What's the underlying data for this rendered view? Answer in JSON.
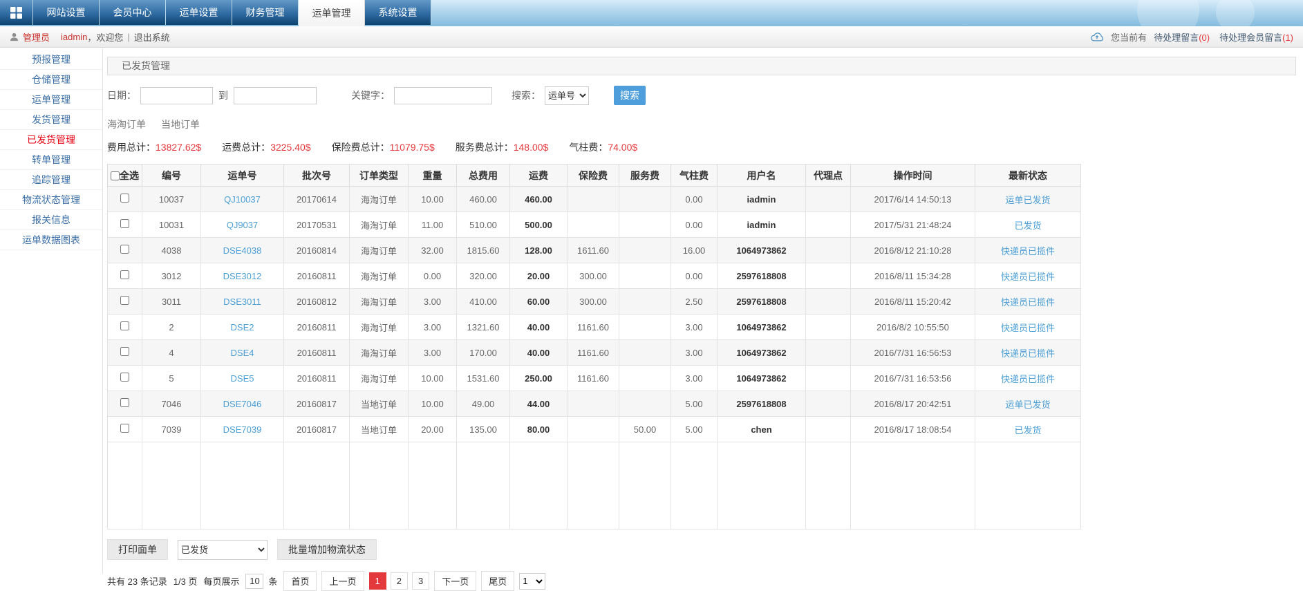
{
  "nav": {
    "tabs": [
      {
        "label": "网站设置",
        "active": false
      },
      {
        "label": "会员中心",
        "active": false
      },
      {
        "label": "运单设置",
        "active": false
      },
      {
        "label": "财务管理",
        "active": false
      },
      {
        "label": "运单管理",
        "active": true
      },
      {
        "label": "系统设置",
        "active": false
      }
    ]
  },
  "user_bar": {
    "role": "管理员",
    "username": "iadmin",
    "welcome_suffix": "，欢迎您",
    "divider": "|",
    "logout": "退出系统",
    "notice_prefix": "您当前有",
    "notices": [
      {
        "label": "待处理留言",
        "count": "(0)"
      },
      {
        "label": "待处理会员留言",
        "count": "(1)"
      }
    ]
  },
  "sidebar": {
    "items": [
      {
        "label": "预报管理",
        "active": false
      },
      {
        "label": "仓储管理",
        "active": false
      },
      {
        "label": "运单管理",
        "active": false
      },
      {
        "label": "发货管理",
        "active": false
      },
      {
        "label": "已发货管理",
        "active": true
      },
      {
        "label": "转单管理",
        "active": false
      },
      {
        "label": "追踪管理",
        "active": false
      },
      {
        "label": "物流状态管理",
        "active": false
      },
      {
        "label": "报关信息",
        "active": false
      },
      {
        "label": "运单数据图表",
        "active": false
      }
    ]
  },
  "panel_title": "已发货管理",
  "filters": {
    "date_label": "日期：",
    "to_label": "到",
    "keyword_label": "关键字：",
    "search_label": "搜索：",
    "date_from_value": "",
    "date_to_value": "",
    "keyword_value": "",
    "search_type_selected": "运单号",
    "search_button": "搜索"
  },
  "order_tabs": [
    {
      "label": "海淘订单"
    },
    {
      "label": "当地订单"
    }
  ],
  "totals": [
    {
      "label": "费用总计：",
      "value": "13827.62$"
    },
    {
      "label": "运费总计：",
      "value": "3225.40$"
    },
    {
      "label": "保险费总计：",
      "value": "11079.75$"
    },
    {
      "label": "服务费总计：",
      "value": "148.00$"
    },
    {
      "label": "气柱费：",
      "value": "74.00$"
    }
  ],
  "table": {
    "select_all_label": "全选",
    "headers": [
      "编号",
      "运单号",
      "批次号",
      "订单类型",
      "重量",
      "总费用",
      "运费",
      "保险费",
      "服务费",
      "气柱费",
      "用户名",
      "代理点",
      "操作时间",
      "最新状态"
    ],
    "rows": [
      {
        "id": "10037",
        "waybill": "QJ10037",
        "batch": "20170614",
        "order_type": "海淘订单",
        "weight": "10.00",
        "total_fee": "460.00",
        "freight": "460.00",
        "insurance": "",
        "service_fee": "",
        "gas_fee": "0.00",
        "username": "iadmin",
        "agent": "",
        "op_time": "2017/6/14 14:50:13",
        "status": "运单已发货"
      },
      {
        "id": "10031",
        "waybill": "QJ9037",
        "batch": "20170531",
        "order_type": "海淘订单",
        "weight": "11.00",
        "total_fee": "510.00",
        "freight": "500.00",
        "insurance": "",
        "service_fee": "",
        "gas_fee": "0.00",
        "username": "iadmin",
        "agent": "",
        "op_time": "2017/5/31 21:48:24",
        "status": "已发货"
      },
      {
        "id": "4038",
        "waybill": "DSE4038",
        "batch": "20160814",
        "order_type": "海淘订单",
        "weight": "32.00",
        "total_fee": "1815.60",
        "freight": "128.00",
        "insurance": "1611.60",
        "service_fee": "",
        "gas_fee": "16.00",
        "username": "1064973862",
        "agent": "",
        "op_time": "2016/8/12 21:10:28",
        "status": "快递员已揽件"
      },
      {
        "id": "3012",
        "waybill": "DSE3012",
        "batch": "20160811",
        "order_type": "海淘订单",
        "weight": "0.00",
        "total_fee": "320.00",
        "freight": "20.00",
        "insurance": "300.00",
        "service_fee": "",
        "gas_fee": "0.00",
        "username": "2597618808",
        "agent": "",
        "op_time": "2016/8/11 15:34:28",
        "status": "快递员已揽件"
      },
      {
        "id": "3011",
        "waybill": "DSE3011",
        "batch": "20160812",
        "order_type": "海淘订单",
        "weight": "3.00",
        "total_fee": "410.00",
        "freight": "60.00",
        "insurance": "300.00",
        "service_fee": "",
        "gas_fee": "2.50",
        "username": "2597618808",
        "agent": "",
        "op_time": "2016/8/11 15:20:42",
        "status": "快递员已揽件"
      },
      {
        "id": "2",
        "waybill": "DSE2",
        "batch": "20160811",
        "order_type": "海淘订单",
        "weight": "3.00",
        "total_fee": "1321.60",
        "freight": "40.00",
        "insurance": "1161.60",
        "service_fee": "",
        "gas_fee": "3.00",
        "username": "1064973862",
        "agent": "",
        "op_time": "2016/8/2 10:55:50",
        "status": "快递员已揽件"
      },
      {
        "id": "4",
        "waybill": "DSE4",
        "batch": "20160811",
        "order_type": "海淘订单",
        "weight": "3.00",
        "total_fee": "170.00",
        "freight": "40.00",
        "insurance": "1161.60",
        "service_fee": "",
        "gas_fee": "3.00",
        "username": "1064973862",
        "agent": "",
        "op_time": "2016/7/31 16:56:53",
        "status": "快递员已揽件"
      },
      {
        "id": "5",
        "waybill": "DSE5",
        "batch": "20160811",
        "order_type": "海淘订单",
        "weight": "10.00",
        "total_fee": "1531.60",
        "freight": "250.00",
        "insurance": "1161.60",
        "service_fee": "",
        "gas_fee": "3.00",
        "username": "1064973862",
        "agent": "",
        "op_time": "2016/7/31 16:53:56",
        "status": "快递员已揽件"
      },
      {
        "id": "7046",
        "waybill": "DSE7046",
        "batch": "20160817",
        "order_type": "当地订单",
        "weight": "10.00",
        "total_fee": "49.00",
        "freight": "44.00",
        "insurance": "",
        "service_fee": "",
        "gas_fee": "5.00",
        "username": "2597618808",
        "agent": "",
        "op_time": "2016/8/17 20:42:51",
        "status": "运单已发货"
      },
      {
        "id": "7039",
        "waybill": "DSE7039",
        "batch": "20160817",
        "order_type": "当地订单",
        "weight": "20.00",
        "total_fee": "135.00",
        "freight": "80.00",
        "insurance": "",
        "service_fee": "50.00",
        "gas_fee": "5.00",
        "username": "chen",
        "agent": "",
        "op_time": "2016/8/17 18:08:54",
        "status": "已发货"
      }
    ]
  },
  "actions": {
    "print_label": "打印面单",
    "status_selected": "已发货",
    "batch_label": "批量增加物流状态"
  },
  "pagination": {
    "total_prefix": "共有",
    "total_count": "23",
    "total_suffix": "条记录",
    "page_ratio": "1/3 页",
    "per_page_label": "每页展示",
    "per_page_value": "10",
    "per_page_unit": "条",
    "first_label": "首页",
    "prev_label": "上一页",
    "pages": [
      "1",
      "2",
      "3"
    ],
    "current_page": "1",
    "next_label": "下一页",
    "last_label": "尾页",
    "jump_value": "1"
  },
  "colors": {
    "nav_dark_blue": "#0e436f",
    "accent_blue": "#4d9edb",
    "link_blue": "#4b9fd5",
    "danger_red": "#e4393c",
    "sidebar_active_red": "#e60012"
  }
}
